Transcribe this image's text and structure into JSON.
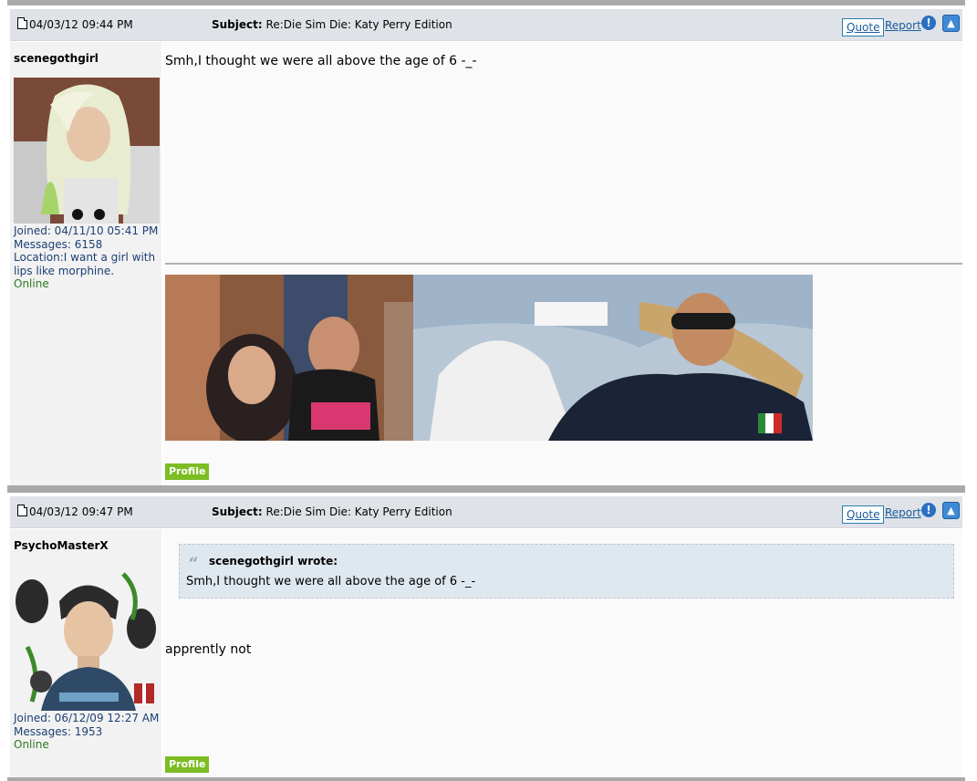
{
  "posts": [
    {
      "date": "04/03/12 09:44 PM",
      "subject_label": "Subject:",
      "subject": "Re:Die Sim Die: Katy Perry Edition",
      "quote_label": "Quote",
      "report_label": "Report",
      "username": "scenegothgirl",
      "joined": "Joined: 04/11/10 05:41 PM",
      "messages": "Messages: 6158",
      "location": "Location:I want a girl with lips like morphine.",
      "status": "Online",
      "message": "Smh,I thought we were all above the age of 6 -_-",
      "profile_label": "Profile"
    },
    {
      "date": "04/03/12 09:47 PM",
      "subject_label": "Subject:",
      "subject": "Re:Die Sim Die: Katy Perry Edition",
      "quote_label": "Quote",
      "report_label": "Report",
      "username": "PsychoMasterX",
      "joined": "Joined: 06/12/09 12:27 AM",
      "messages": "Messages: 1953",
      "status": "Online",
      "quote_author": "scenegothgirl wrote:",
      "quote_text": "Smh,I thought we were all above the age of 6 -_-",
      "message": "apprently not",
      "profile_label": "Profile"
    }
  ],
  "icons": {
    "post": "document-icon",
    "info": "info-icon",
    "top": "back-to-top-icon",
    "quote": "quote-marks-icon"
  }
}
